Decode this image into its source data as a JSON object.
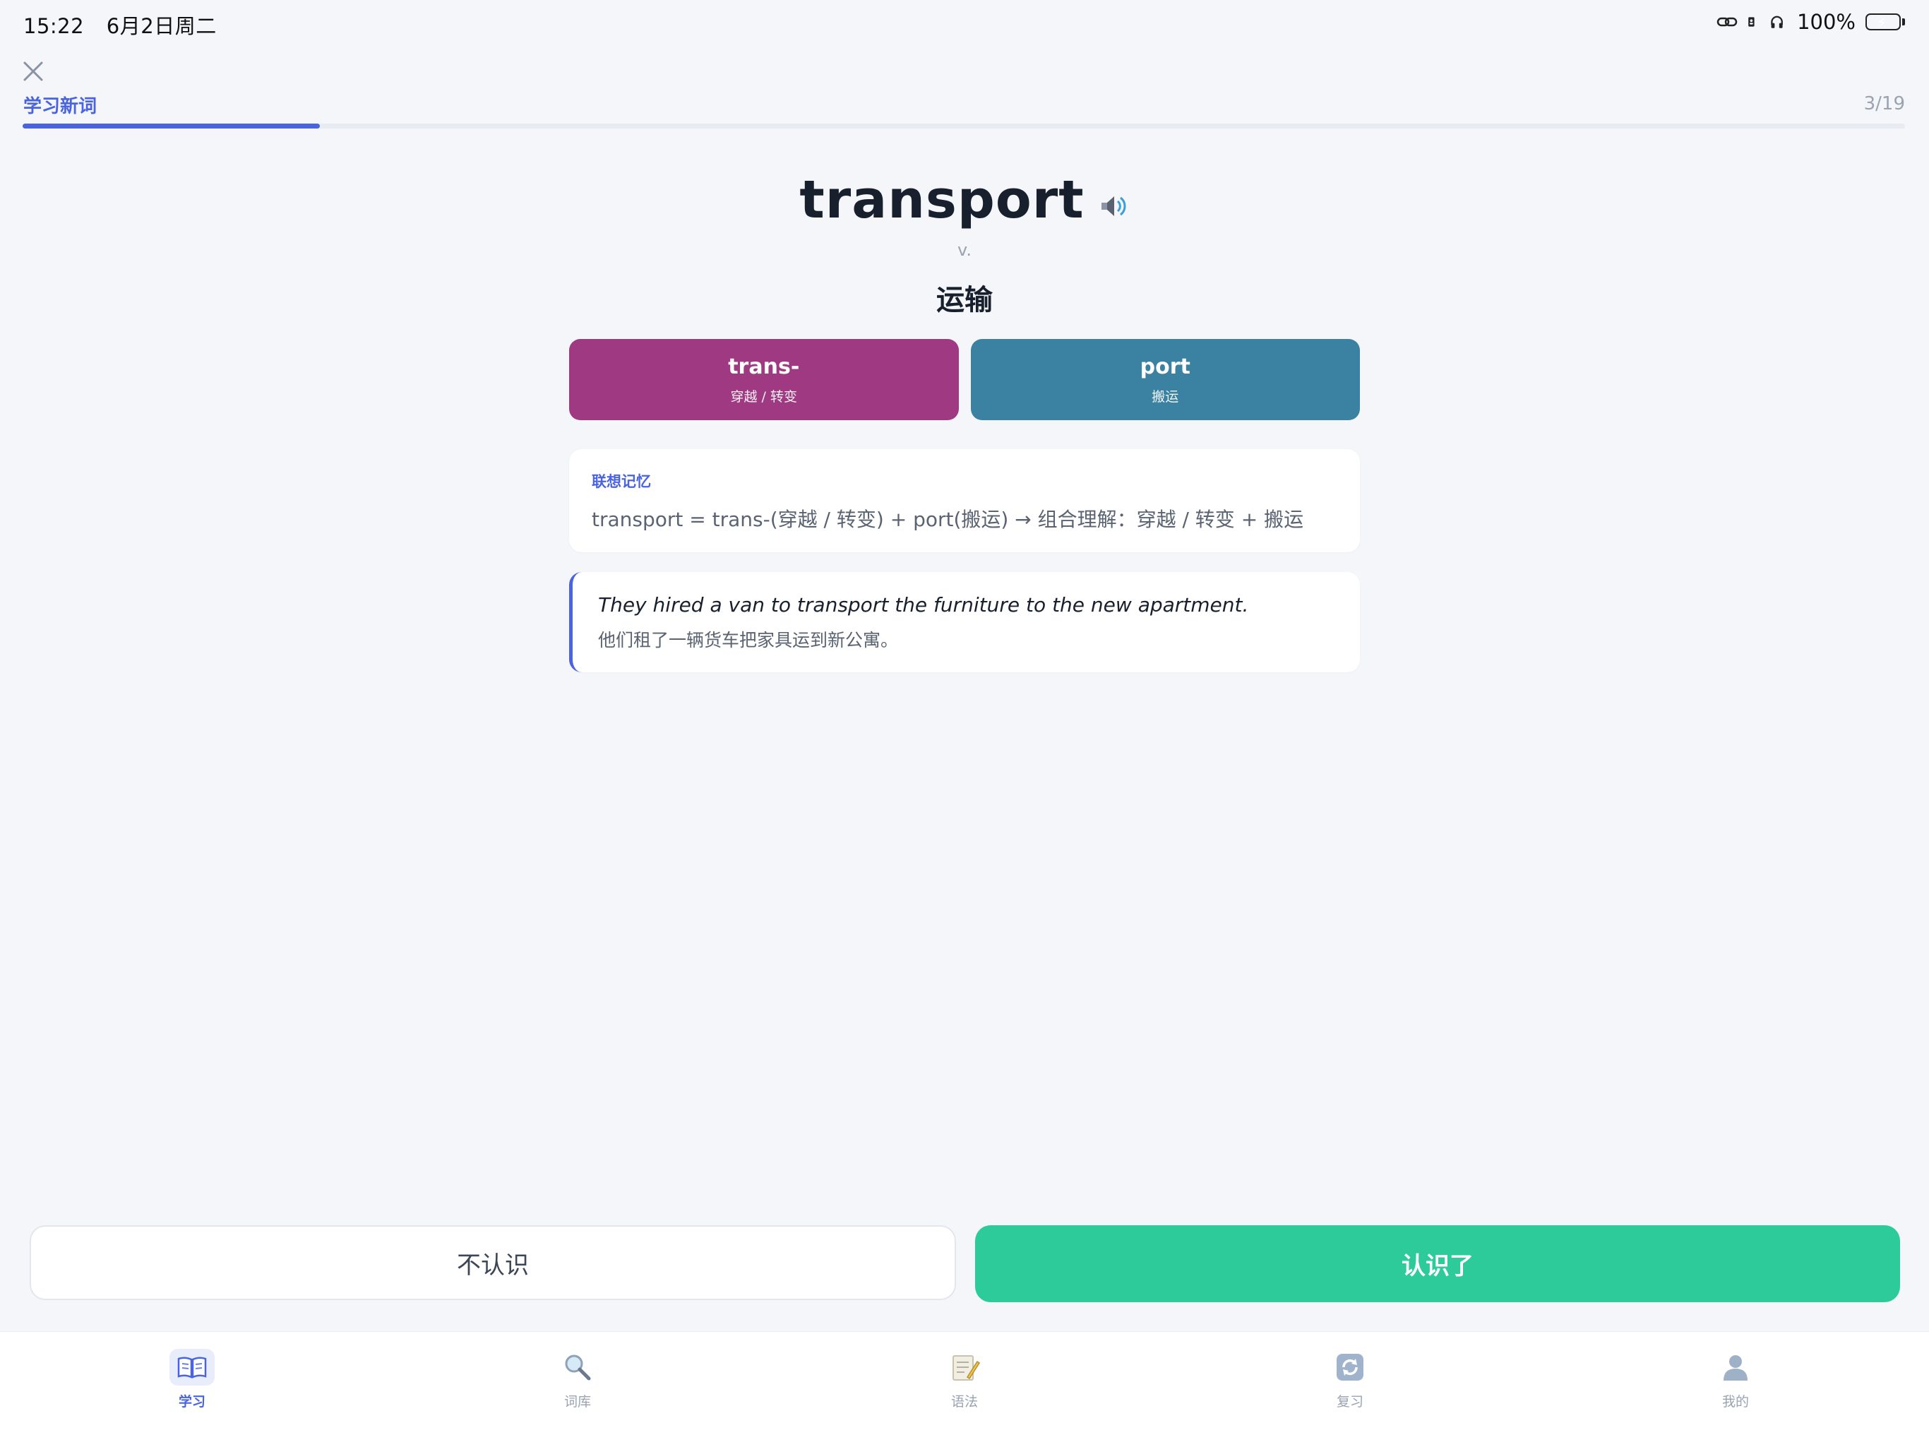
{
  "status_bar": {
    "time": "15:22",
    "date": "6月2日周二",
    "battery": "100%"
  },
  "header": {
    "title": "学习新词",
    "counter": "3/19",
    "progress_fraction": 0.158
  },
  "word": {
    "text": "transport",
    "pos": "v.",
    "meaning": "运输"
  },
  "morphemes": [
    {
      "text": "trans-",
      "meaning": "穿越 / 转变",
      "color": "#9f3a82"
    },
    {
      "text": "port",
      "meaning": "搬运",
      "color": "#3b82a2"
    }
  ],
  "association": {
    "label": "联想记忆",
    "text": "transport = trans-(穿越 / 转变) + port(搬运) → 组合理解：穿越 / 转变 + 搬运"
  },
  "example": {
    "en": "They hired a van to transport the furniture to the new apartment.",
    "zh": "他们租了一辆货车把家具运到新公寓。"
  },
  "actions": {
    "unknown_label": "不认识",
    "known_label": "认识了"
  },
  "tabs": [
    {
      "label": "学习",
      "icon": "book-icon",
      "active": true
    },
    {
      "label": "词库",
      "icon": "magnifier-icon",
      "active": false
    },
    {
      "label": "语法",
      "icon": "memo-icon",
      "active": false
    },
    {
      "label": "复习",
      "icon": "refresh-icon",
      "active": false
    },
    {
      "label": "我的",
      "icon": "user-icon",
      "active": false
    }
  ],
  "colors": {
    "accent": "#4a63e0",
    "success": "#2ecb9a",
    "background": "#f4f6fa"
  }
}
